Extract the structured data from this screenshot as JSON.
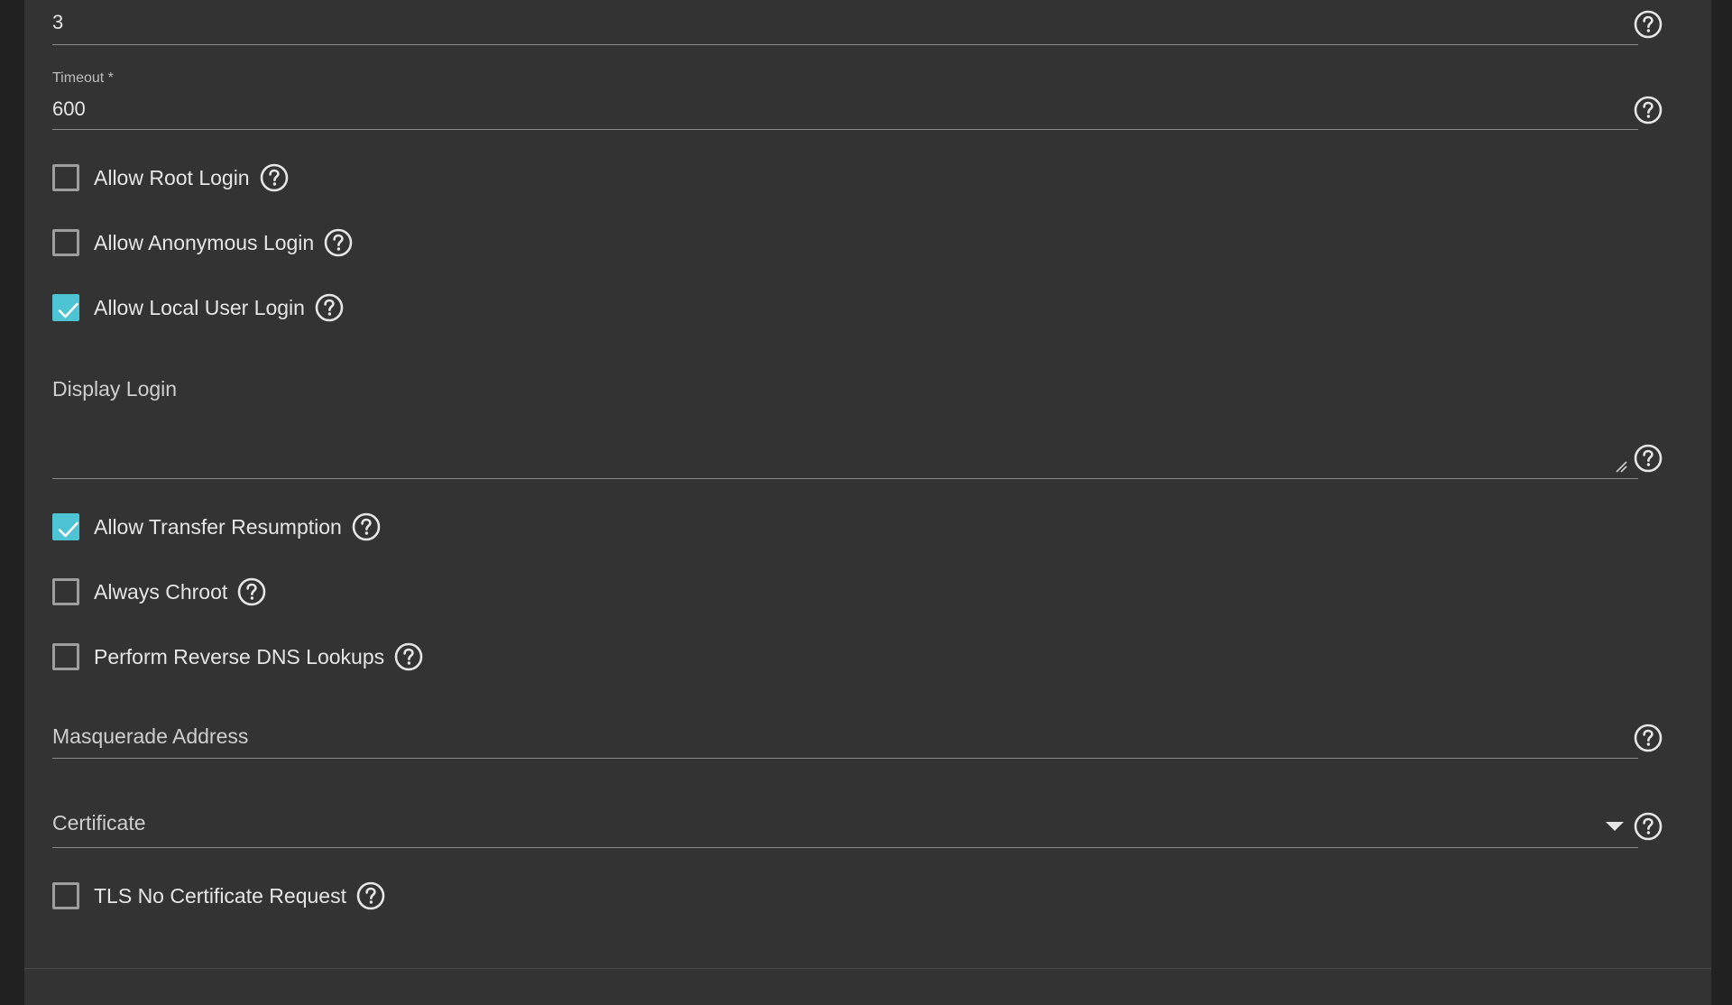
{
  "form": {
    "top_field": {
      "value": "3"
    },
    "timeout": {
      "label": "Timeout *",
      "value": "600"
    },
    "allow_root_login": {
      "label": "Allow Root Login",
      "checked": false
    },
    "allow_anonymous_login": {
      "label": "Allow Anonymous Login",
      "checked": false
    },
    "allow_local_user_login": {
      "label": "Allow Local User Login",
      "checked": true
    },
    "display_login": {
      "placeholder": "Display Login",
      "value": ""
    },
    "allow_transfer_resumption": {
      "label": "Allow Transfer Resumption",
      "checked": true
    },
    "always_chroot": {
      "label": "Always Chroot",
      "checked": false
    },
    "reverse_dns": {
      "label": "Perform Reverse DNS Lookups",
      "checked": false
    },
    "masquerade_address": {
      "placeholder": "Masquerade Address",
      "value": ""
    },
    "certificate": {
      "placeholder": "Certificate",
      "value": ""
    },
    "tls_no_cert_request": {
      "label": "TLS No Certificate Request",
      "checked": false
    }
  },
  "icons": {
    "help": "help-circle-icon",
    "check": "check-icon",
    "dropdown": "chevron-down-icon",
    "resize": "resize-grip-icon"
  },
  "colors": {
    "background": "#212121",
    "panel": "#333333",
    "accent": "#4ec3d3",
    "text": "#e6e6e6",
    "underline": "#8a8a8a"
  }
}
